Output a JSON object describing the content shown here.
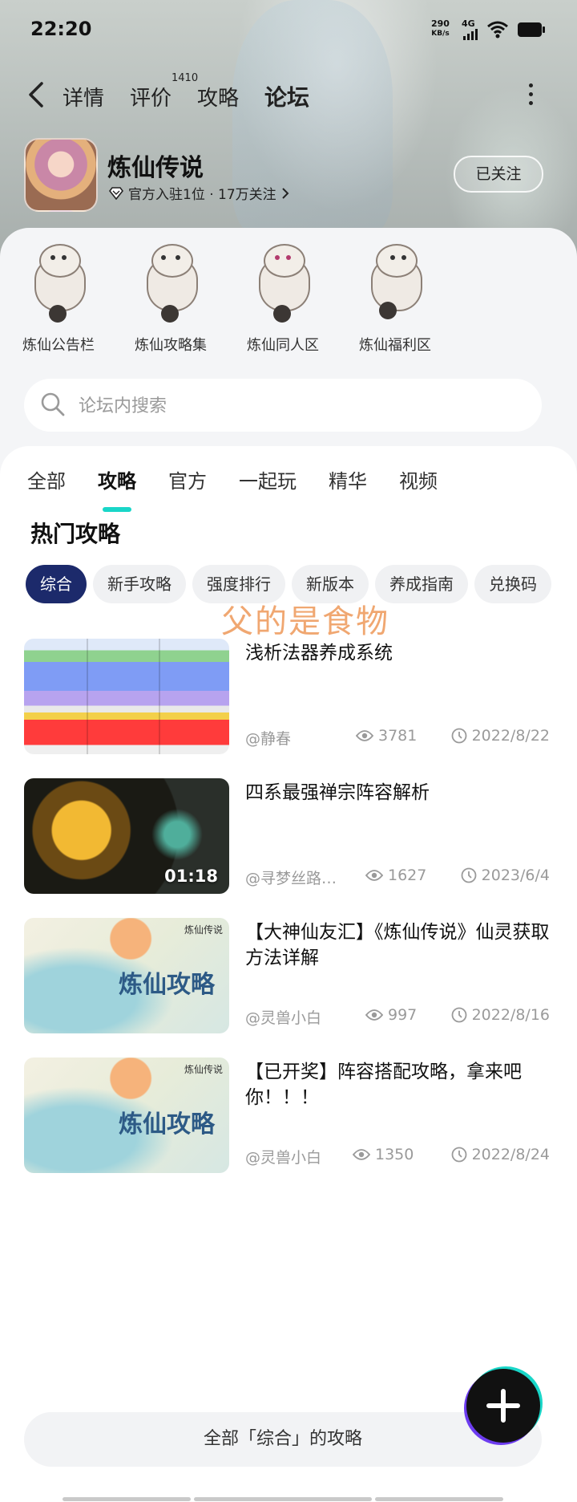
{
  "status_bar": {
    "time": "22:20",
    "speed_value": "290",
    "speed_unit": "KB/s",
    "network": "4G"
  },
  "nav": {
    "tabs": [
      {
        "label": "详情"
      },
      {
        "label": "评价"
      },
      {
        "label": "攻略"
      },
      {
        "label": "论坛"
      }
    ],
    "review_count": "1410",
    "active_tab": "论坛"
  },
  "game": {
    "name": "炼仙传说",
    "meta": "官方入驻1位 · 17万关注",
    "follow_label": "已关注"
  },
  "boards": [
    {
      "label": "炼仙公告栏"
    },
    {
      "label": "炼仙攻略集"
    },
    {
      "label": "炼仙同人区"
    },
    {
      "label": "炼仙福利区"
    }
  ],
  "search": {
    "placeholder": "论坛内搜索"
  },
  "content_tabs": [
    {
      "label": "全部"
    },
    {
      "label": "攻略"
    },
    {
      "label": "官方"
    },
    {
      "label": "一起玩"
    },
    {
      "label": "精华"
    },
    {
      "label": "视频"
    }
  ],
  "active_content_tab": "攻略",
  "section_title": "热门攻略",
  "filters": [
    {
      "label": "综合"
    },
    {
      "label": "新手攻略"
    },
    {
      "label": "强度排行"
    },
    {
      "label": "新版本"
    },
    {
      "label": "养成指南"
    },
    {
      "label": "兑换码"
    }
  ],
  "active_filter": "综合",
  "overlay_text": "父的是食物",
  "posts": [
    {
      "title": "浅析法器养成系统",
      "author": "@静春",
      "views": "3781",
      "date": "2022/8/22"
    },
    {
      "title": "四系最强禅宗阵容解析",
      "author": "@寻梦丝路…",
      "views": "1627",
      "date": "2023/6/4",
      "duration": "01:18"
    },
    {
      "title": "【大神仙友汇】《炼仙传说》仙灵获取方法详解",
      "author": "@灵兽小白",
      "views": "997",
      "date": "2022/8/16",
      "thumb_text": "炼仙攻略",
      "thumb_logo": "炼仙传说"
    },
    {
      "title": "【已开奖】阵容搭配攻略，拿来吧你！！！",
      "author": "@灵兽小白",
      "views": "1350",
      "date": "2022/8/24",
      "thumb_text": "炼仙攻略",
      "thumb_logo": "炼仙传说"
    }
  ],
  "all_button_label": "全部「综合」的攻略",
  "colors": {
    "accent": "#19d6c8",
    "chip_active": "#1c2a6b"
  }
}
